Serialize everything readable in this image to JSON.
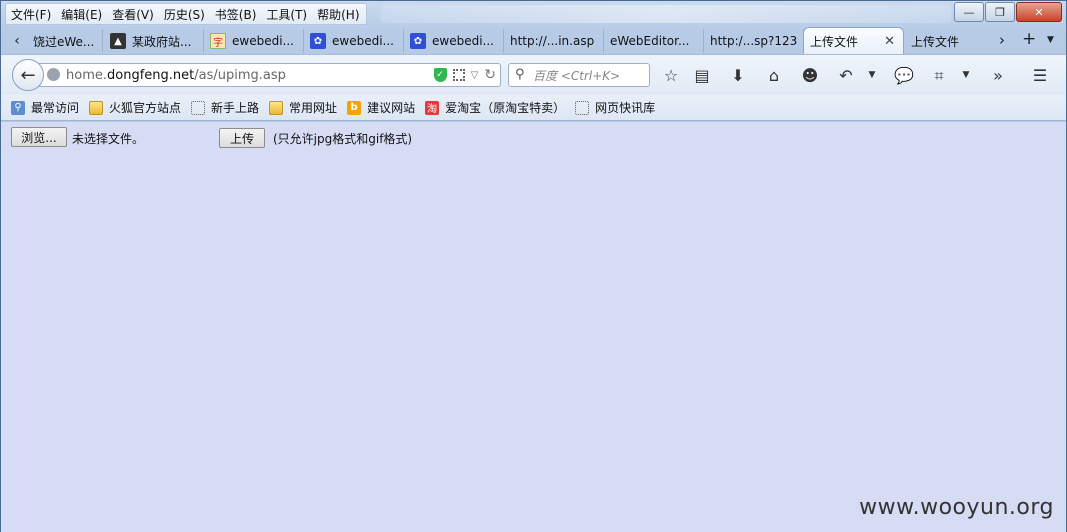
{
  "menubar": {
    "items": [
      "文件(F)",
      "编辑(E)",
      "查看(V)",
      "历史(S)",
      "书签(B)",
      "工具(T)",
      "帮助(H)"
    ]
  },
  "tabs": [
    {
      "label": "饶过eWe...",
      "icon": "page-icon"
    },
    {
      "label": "某政府站...",
      "icon": "site-icon"
    },
    {
      "label": "ewebedi...",
      "icon": "document-icon"
    },
    {
      "label": "ewebedi...",
      "icon": "baidu-paw-icon"
    },
    {
      "label": "ewebedi...",
      "icon": "baidu-paw-icon"
    },
    {
      "label": "http://...in.asp",
      "icon": ""
    },
    {
      "label": "eWebEditor...",
      "icon": ""
    },
    {
      "label": "http:/...sp?123",
      "icon": ""
    },
    {
      "label": "上传文件",
      "icon": "",
      "active": true
    },
    {
      "label": "上传文件",
      "icon": ""
    }
  ],
  "navbar": {
    "url_prefix": "home.",
    "url_domain": "dongfeng.net",
    "url_path": "/as/upimg.asp",
    "search_placeholder": "百度 <Ctrl+K>"
  },
  "bookmarks": [
    {
      "label": "最常访问",
      "icon": "search-icon"
    },
    {
      "label": "火狐官方站点",
      "icon": "folder-icon"
    },
    {
      "label": "新手上路",
      "icon": "dotted-page-icon"
    },
    {
      "label": "常用网址",
      "icon": "folder-icon"
    },
    {
      "label": "建议网站",
      "icon": "bing-icon"
    },
    {
      "label": "爱淘宝（原淘宝特卖）",
      "icon": "taobao-icon"
    },
    {
      "label": "网页快讯库",
      "icon": "dotted-page-icon"
    }
  ],
  "page": {
    "browse_label": "浏览...",
    "file_status": "未选择文件。",
    "upload_label": "上传",
    "hint": "(只允许jpg格式和gif格式)"
  },
  "watermark": "www.wooyun.org"
}
